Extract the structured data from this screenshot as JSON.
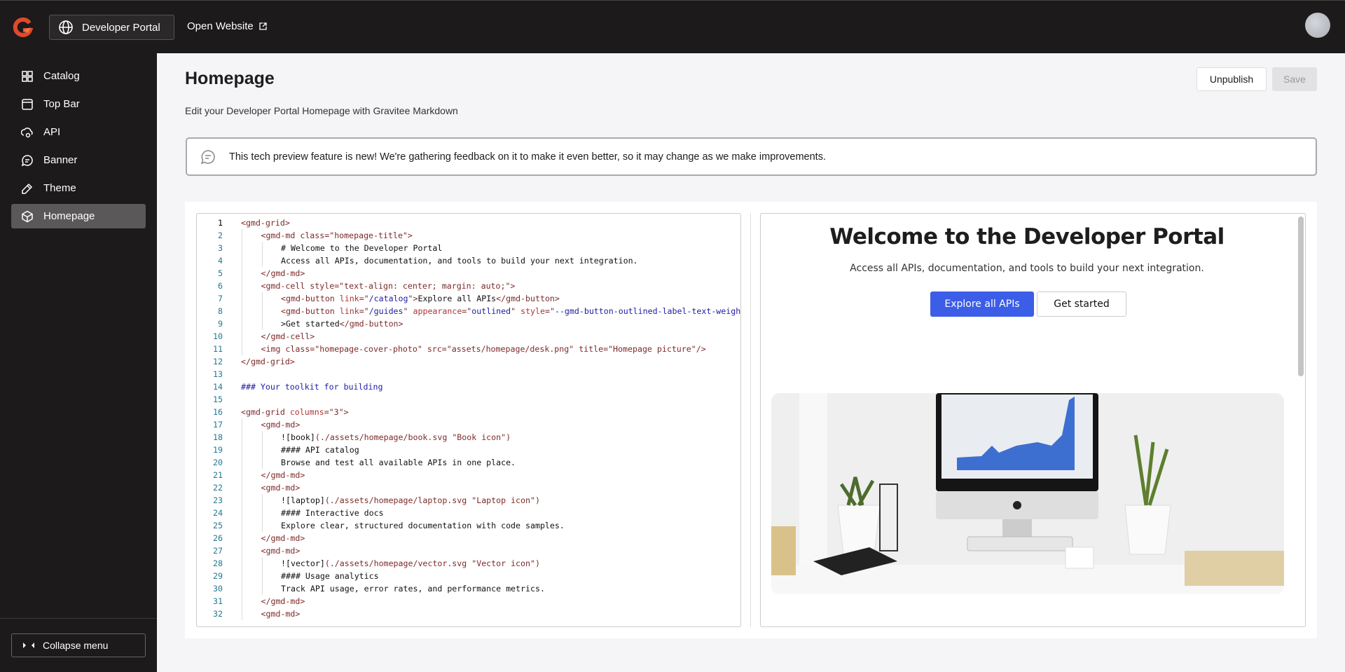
{
  "topbar": {
    "portal_label": "Developer Portal",
    "open_website_label": "Open Website"
  },
  "sidebar": {
    "items": [
      {
        "label": "Catalog",
        "icon": "grid-icon"
      },
      {
        "label": "Top Bar",
        "icon": "window-icon"
      },
      {
        "label": "API",
        "icon": "cloud-gear-icon"
      },
      {
        "label": "Banner",
        "icon": "chat-icon"
      },
      {
        "label": "Theme",
        "icon": "eyedropper-icon"
      },
      {
        "label": "Homepage",
        "icon": "cube-icon",
        "active": true
      }
    ],
    "collapse_label": "Collapse menu"
  },
  "page": {
    "title": "Homepage",
    "subtitle": "Edit your Developer Portal Homepage with Gravitee Markdown",
    "unpublish_label": "Unpublish",
    "save_label": "Save"
  },
  "banner": {
    "text": "This tech preview feature is new! We're gathering feedback on it to make it even better, so it may change as we make improvements."
  },
  "editor": {
    "current_line": 1,
    "lines": [
      [
        [
          "r",
          "<gmd-grid>"
        ]
      ],
      [
        [
          "r",
          "<gmd-md class=\"homepage-title\">"
        ]
      ],
      [
        [
          "k",
          "# Welcome to the Developer Portal"
        ]
      ],
      [
        [
          "k",
          "Access all APIs, documentation, and tools to build your next integration."
        ]
      ],
      [
        [
          "r",
          "</gmd-md>"
        ]
      ],
      [
        [
          "r",
          "<gmd-cell style=\"text-align: center; margin: auto;\">"
        ]
      ],
      [
        [
          "r",
          "<gmd-button "
        ],
        [
          "a",
          "link"
        ],
        [
          "r",
          "=\""
        ],
        [
          "b",
          "/catalog"
        ],
        [
          "r",
          "\">"
        ],
        [
          "k",
          "Explore all APIs"
        ],
        [
          "r",
          "</gmd-button>"
        ]
      ],
      [
        [
          "r",
          "<gmd-button "
        ],
        [
          "a",
          "link"
        ],
        [
          "r",
          "=\""
        ],
        [
          "b",
          "/guides"
        ],
        [
          "r",
          "\" "
        ],
        [
          "a",
          "appearance"
        ],
        [
          "r",
          "=\""
        ],
        [
          "b",
          "outlined"
        ],
        [
          "r",
          "\" "
        ],
        [
          "a",
          "style"
        ],
        [
          "r",
          "=\""
        ],
        [
          "b",
          "--gmd-button-outlined-label-text-weight"
        ]
      ],
      [
        [
          "k",
          ">Get started"
        ],
        [
          "r",
          "</gmd-button>"
        ]
      ],
      [
        [
          "r",
          "</gmd-cell>"
        ]
      ],
      [
        [
          "r",
          "<img class=\"homepage-cover-photo\" src=\"assets/homepage/desk.png\" title=\"Homepage picture\"/>"
        ]
      ],
      [
        [
          "r",
          "</gmd-grid>"
        ]
      ],
      [],
      [
        [
          "b",
          "### Your toolkit for building"
        ]
      ],
      [],
      [
        [
          "r",
          "<gmd-grid "
        ],
        [
          "a",
          "columns"
        ],
        [
          "r",
          "=\"3\">"
        ]
      ],
      [
        [
          "r",
          "<gmd-md>"
        ]
      ],
      [
        [
          "k",
          "![book]"
        ],
        [
          "r",
          "(./assets/homepage/book.svg \"Book icon\")"
        ]
      ],
      [
        [
          "k",
          "#### API catalog"
        ]
      ],
      [
        [
          "k",
          "Browse and test all available APIs in one place."
        ]
      ],
      [
        [
          "r",
          "</gmd-md>"
        ]
      ],
      [
        [
          "r",
          "<gmd-md>"
        ]
      ],
      [
        [
          "k",
          "![laptop]"
        ],
        [
          "r",
          "(./assets/homepage/laptop.svg \"Laptop icon\")"
        ]
      ],
      [
        [
          "k",
          "#### Interactive docs"
        ]
      ],
      [
        [
          "k",
          "Explore clear, structured documentation with code samples."
        ]
      ],
      [
        [
          "r",
          "</gmd-md>"
        ]
      ],
      [
        [
          "r",
          "<gmd-md>"
        ]
      ],
      [
        [
          "k",
          "![vector]"
        ],
        [
          "r",
          "(./assets/homepage/vector.svg \"Vector icon\")"
        ]
      ],
      [
        [
          "k",
          "#### Usage analytics"
        ]
      ],
      [
        [
          "k",
          "Track API usage, error rates, and performance metrics."
        ]
      ],
      [
        [
          "r",
          "</gmd-md>"
        ]
      ],
      [
        [
          "r",
          "<gmd-md>"
        ]
      ]
    ],
    "indents": [
      0,
      1,
      2,
      2,
      1,
      1,
      2,
      2,
      2,
      1,
      1,
      0,
      0,
      0,
      0,
      0,
      1,
      2,
      2,
      2,
      1,
      1,
      2,
      2,
      2,
      1,
      1,
      2,
      2,
      2,
      1,
      1
    ]
  },
  "preview": {
    "title": "Welcome to the Developer Portal",
    "subtitle": "Access all APIs, documentation, and tools to build your next integration.",
    "primary_button": "Explore all APIs",
    "secondary_button": "Get started",
    "image_title": "Homepage picture"
  },
  "colors": {
    "accent": "#3b5de7",
    "topbar": "#1c1a1b",
    "logo": "#e0492a"
  }
}
